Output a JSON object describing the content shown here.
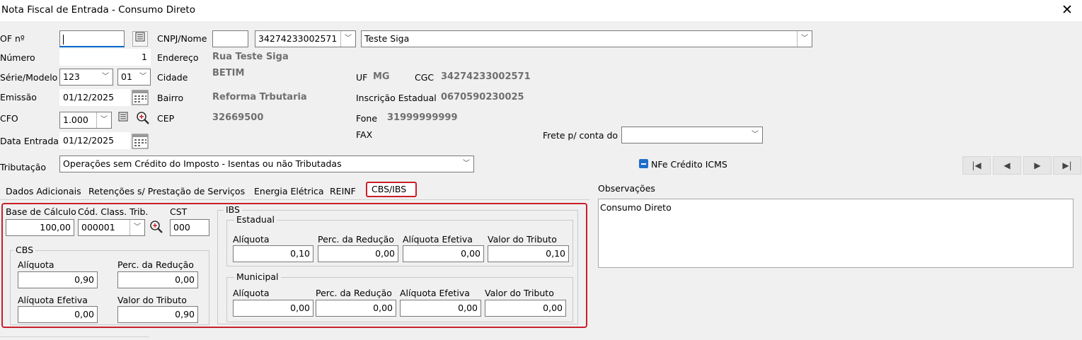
{
  "window": {
    "title": "Nota Fiscal de Entrada - Consumo Direto",
    "close_glyph": "✕"
  },
  "form": {
    "of_label": "OF nº",
    "of_value": "",
    "numero_label": "Número",
    "numero_value": "1",
    "serie_label": "Série/Modelo",
    "serie_value": "123",
    "modelo_value": "01",
    "emissao_label": "Emissão",
    "emissao_value": "01/12/2025",
    "cfo_label": "CFO",
    "cfo_value": "1.000",
    "data_entrada_label": "Data Entrada",
    "data_entrada_value": "01/12/2025",
    "tributacao_label": "Tributação",
    "tributacao_value": "Operações sem Crédito do Imposto - Isentas ou não Tributadas"
  },
  "supplier": {
    "cnpj_nome_label": "CNPJ/Nome",
    "cnpj_value": "34274233002571",
    "nome_value": "Teste Siga",
    "endereco_label": "Endereço",
    "endereco_value": "Rua Teste Siga",
    "cidade_label": "Cidade",
    "cidade_value": "BETIM",
    "uf_label": "UF",
    "uf_value": "MG",
    "cgc_label": "CGC",
    "cgc_value": "34274233002571",
    "bairro_label": "Bairro",
    "bairro_value": "Reforma Trbutaria",
    "ie_label": "Inscrição Estadual",
    "ie_value": "0670590230025",
    "cep_label": "CEP",
    "cep_value": "32669500",
    "fone_label": "Fone",
    "fone_value": "31999999999",
    "fax_label": "FAX",
    "frete_label": "Frete p/ conta do",
    "frete_value": ""
  },
  "nfe_credito": {
    "label": "NFe Crédito ICMS",
    "checked": true
  },
  "tabs": [
    {
      "label": "Dados Adicionais"
    },
    {
      "label": "Retenções s/ Prestação de Serviços"
    },
    {
      "label": "Energia Elétrica"
    },
    {
      "label": "REINF"
    },
    {
      "label": "CBS/IBS",
      "selected": true
    }
  ],
  "cbs_ibs": {
    "base_label": "Base de Cálculo",
    "base_value": "100,00",
    "class_label": "Cód. Class. Trib.",
    "class_value": "000001",
    "cst_label": "CST",
    "cst_value": "000",
    "cbs": {
      "title": "CBS",
      "aliquota_label": "Alíquota",
      "aliquota_value": "0,90",
      "reducao_label": "Perc. da Redução",
      "reducao_value": "0,00",
      "efetiva_label": "Alíquota Efetiva",
      "efetiva_value": "0,00",
      "tributo_label": "Valor do Tributo",
      "tributo_value": "0,90"
    },
    "ibs": {
      "title": "IBS",
      "estadual": {
        "title": "Estadual",
        "aliquota_label": "Alíquota",
        "aliquota_value": "0,10",
        "reducao_label": "Perc. da Redução",
        "reducao_value": "0,00",
        "efetiva_label": "Alíquota Efetiva",
        "efetiva_value": "0,00",
        "tributo_label": "Valor do Tributo",
        "tributo_value": "0,10"
      },
      "municipal": {
        "title": "Municipal",
        "aliquota_label": "Alíquota",
        "aliquota_value": "0,00",
        "reducao_label": "Perc. da Redução",
        "reducao_value": "0,00",
        "efetiva_label": "Alíquota Efetiva",
        "efetiva_value": "0,00",
        "tributo_label": "Valor do Tributo",
        "tributo_value": "0,00"
      }
    }
  },
  "observacoes": {
    "label": "Observações",
    "value": "Consumo Direto"
  },
  "nav": {
    "first": "|◀",
    "prev": "◀",
    "next": "▶",
    "last": "▶|"
  },
  "colors": {
    "highlight_red": "#c8202a",
    "checkbox_blue": "#1e6fc8"
  }
}
